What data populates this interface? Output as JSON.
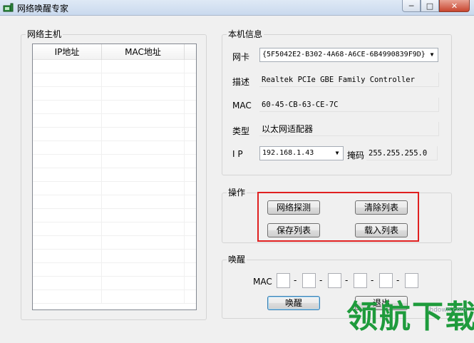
{
  "window": {
    "title": "网络唤醒专家",
    "controls": [
      "─",
      "□",
      "✕"
    ]
  },
  "hosts_group": {
    "title": "网络主机",
    "columns": [
      "IP地址",
      "MAC地址"
    ],
    "rows": []
  },
  "local_info": {
    "title": "本机信息",
    "nic_label": "网卡",
    "nic_value": "{5F5042E2-B302-4A68-A6CE-6B4990839F9D}",
    "desc_label": "描述",
    "desc_value": "Realtek PCIe GBE Family Controller",
    "mac_label": "MAC",
    "mac_value": "60-45-CB-63-CE-7C",
    "type_label": "类型",
    "type_value": "以太网适配器",
    "ip_label": "I P",
    "ip_value": "192.168.1.43",
    "mask_label": "掩码",
    "mask_value": "255.255.255.0"
  },
  "operations": {
    "title": "操作",
    "scan": "网络探测",
    "clear": "清除列表",
    "save": "保存列表",
    "load": "载入列表"
  },
  "wake": {
    "title": "唤醒",
    "mac_label": "MAC",
    "mac_octets": [
      "",
      "",
      "",
      "",
      "",
      ""
    ],
    "separator": "-",
    "wake_button": "唤醒",
    "exit_button": "退出"
  },
  "watermark": {
    "text": "领航下载",
    "url": "lhdown.com"
  }
}
